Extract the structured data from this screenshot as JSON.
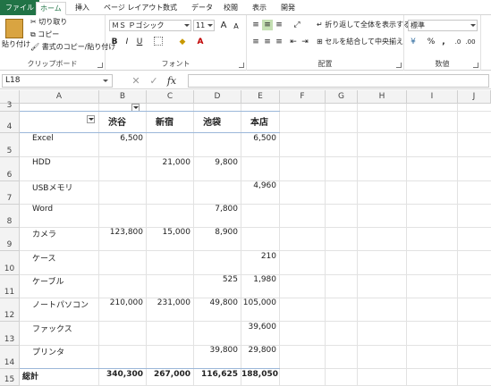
{
  "tabs": [
    "ファイル",
    "ホーム",
    "挿入",
    "ページ レイアウト",
    "数式",
    "データ",
    "校閲",
    "表示",
    "開発"
  ],
  "active_tab": "ホーム",
  "ribbon": {
    "clipboard": {
      "paste": "貼り付け",
      "cut": "切り取り",
      "copy": "コピー",
      "format_painter": "書式のコピー/貼り付け",
      "label": "クリップボード"
    },
    "font": {
      "name": "ＭＳ Ｐゴシック",
      "size": "11",
      "grow": "A",
      "shrink": "A",
      "bold": "B",
      "italic": "I",
      "underline": "U",
      "label": "フォント"
    },
    "alignment": {
      "wrap": "折り返して全体を表示する",
      "merge": "セルを結合して中央揃え",
      "label": "配置"
    },
    "number": {
      "format": "標準",
      "percent": "%",
      "comma": ",",
      "label": "数値"
    }
  },
  "formula_bar": {
    "name_box": "L18",
    "cancel": "✕",
    "enter": "✓",
    "fx": "fx",
    "value": ""
  },
  "columns": [
    "A",
    "B",
    "C",
    "D",
    "E",
    "F",
    "G",
    "H",
    "I",
    "J"
  ],
  "rows": [
    "3",
    "4",
    "5",
    "6",
    "7",
    "8",
    "9",
    "10",
    "11",
    "12",
    "13",
    "14",
    "15"
  ],
  "pivot": {
    "headers": [
      "渋谷",
      "新宿",
      "池袋",
      "本店"
    ],
    "items": [
      {
        "name": "Excel",
        "values": [
          "6,500",
          "",
          "",
          "6,500"
        ]
      },
      {
        "name": "HDD",
        "values": [
          "",
          "21,000",
          "9,800",
          ""
        ]
      },
      {
        "name": "USBメモリ",
        "values": [
          "",
          "",
          "",
          "4,960"
        ]
      },
      {
        "name": "Word",
        "values": [
          "",
          "",
          "7,800",
          ""
        ]
      },
      {
        "name": "カメラ",
        "values": [
          "123,800",
          "15,000",
          "8,900",
          ""
        ]
      },
      {
        "name": "ケース",
        "values": [
          "",
          "",
          "",
          "210"
        ]
      },
      {
        "name": "ケーブル",
        "values": [
          "",
          "",
          "525",
          "1,980"
        ]
      },
      {
        "name": "ノートパソコン",
        "values": [
          "210,000",
          "231,000",
          "49,800",
          "105,000"
        ]
      },
      {
        "name": "ファックス",
        "values": [
          "",
          "",
          "",
          "39,600"
        ]
      },
      {
        "name": "プリンタ",
        "values": [
          "",
          "",
          "39,800",
          "29,800"
        ]
      }
    ],
    "total_label": "総計",
    "totals": [
      "340,300",
      "267,000",
      "116,625",
      "188,050"
    ]
  },
  "colors": {
    "excel_green": "#217346",
    "pivot_line": "#9bb7d9"
  }
}
